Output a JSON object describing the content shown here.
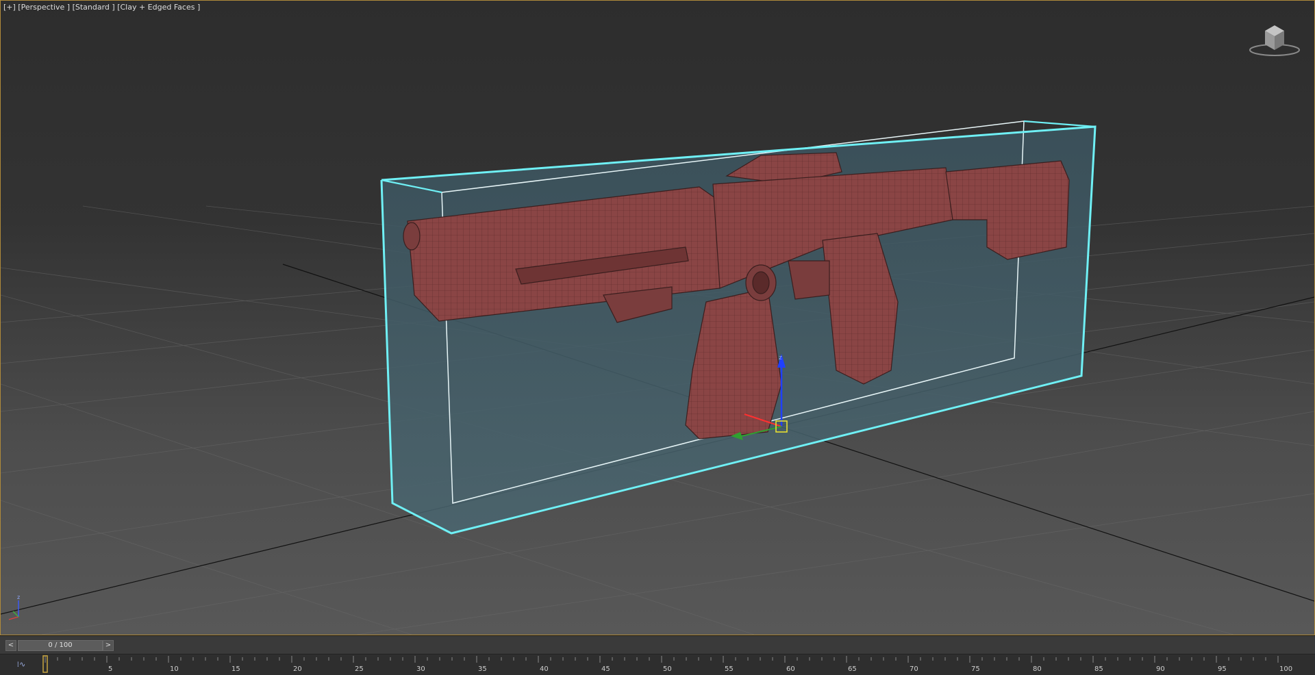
{
  "viewport": {
    "label": "[+] [Perspective ] [Standard ] [Clay + Edged Faces ]"
  },
  "viewcube": {
    "icon": "viewcube-icon"
  },
  "timeline": {
    "prev_label": "<",
    "next_label": ">",
    "slider_text": "0 / 100",
    "current_frame": 0,
    "total_frames": 100,
    "tick_labels": [
      "5",
      "10",
      "15",
      "20",
      "25",
      "30",
      "35",
      "40",
      "45",
      "50",
      "55",
      "60",
      "65",
      "70",
      "75",
      "80",
      "85",
      "90",
      "95",
      "100"
    ],
    "curve_icon": "mini-curve-editor-icon"
  },
  "colors": {
    "selection": "#6ff0f5",
    "model": "#8a4545",
    "frame_border": "#b08a3a",
    "frame_marker": "#c9a640"
  }
}
